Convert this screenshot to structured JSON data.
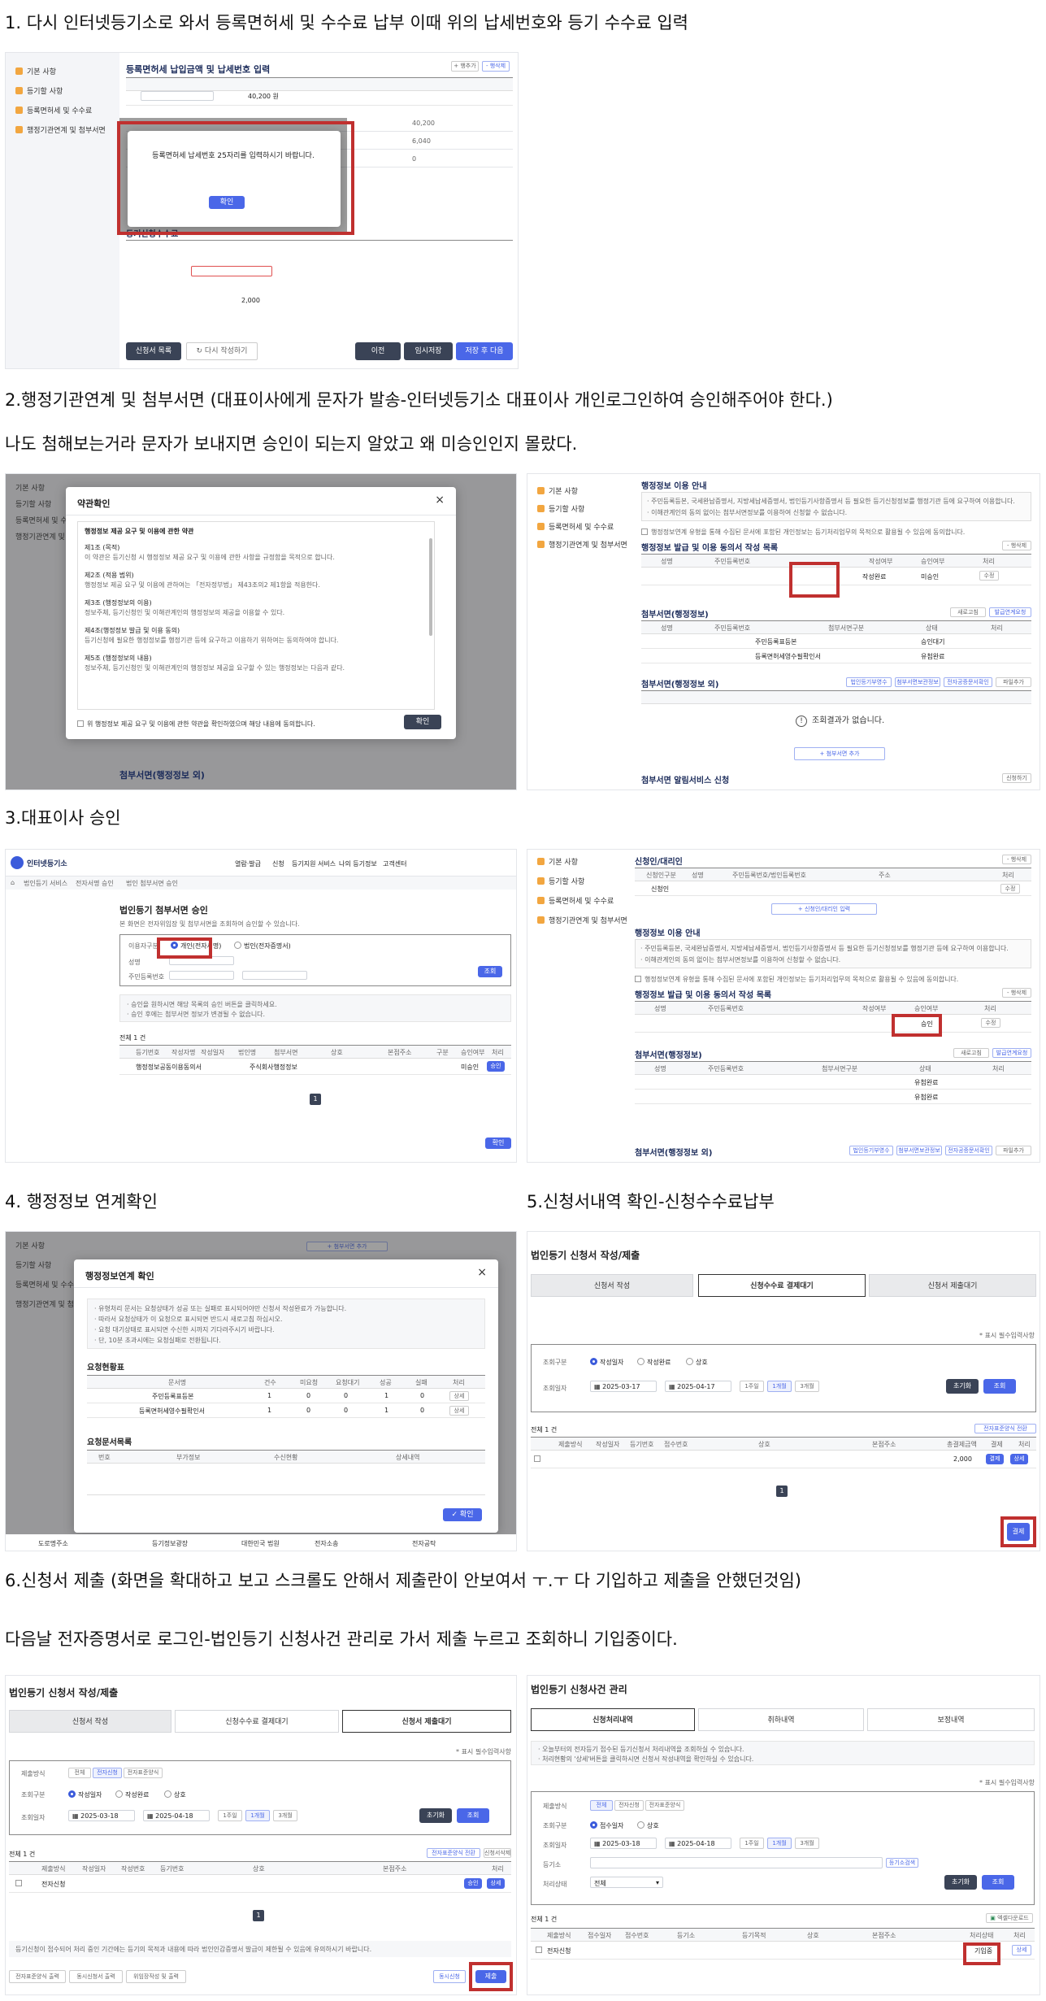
{
  "captions": {
    "c1": "1. 다시 인터넷등기소로 와서 등록면허세 및 수수료 납부 이때 위의 납세번호와 등기 수수료 입력",
    "c2a": "2.행정기관연계 및 첨부서면 (대표이사에게 문자가 발송-인터넷등기소 대표이사 개인로그인하여 승인해주어야 한다.)",
    "c2b": "나도 첨해보는거라 문자가 보내지면 승인이 되는지 알았고 왜 미승인인지 몰랐다.",
    "c3": "3.대표이사 승인",
    "c4": "4. 행정정보 연계확인",
    "c5": "5.신청서내역 확인-신청수수료납부",
    "c6a": "6.신청서 제출 (화면을 확대하고 보고 스크롤도 안해서 제출란이 안보여서 ㅜ.ㅜ 다 기입하고 제출을 안했던것임)",
    "c6b": "다음날 전자증명서로 로그인-법인등기 신청사건 관리로 가서 제출 누르고 조회하니 기입중이다."
  },
  "sidebar": {
    "items": [
      "기본 사항",
      "등기할 사항",
      "등록면허세 및 수수료",
      "행정기관연계 및 첨부서면"
    ]
  },
  "s1": {
    "section_title": "등록면허세 납입금액 및 납세번호 입력",
    "amount": "40,200 원",
    "amount2": "40,200",
    "amount3": "6,040",
    "amount4": "0",
    "fee_title": "등기신청수수료",
    "fee_amount": "2,000",
    "modal_text": "등록면허세 납세번호 25자리를 입력하시기 바랍니다.",
    "modal_ok": "확인",
    "btn_list": "신청서 목록",
    "btn_rewrite": "다시 작성하기",
    "btn_prev": "이전",
    "btn_temp": "임시저장",
    "btn_save_next": "저장 후 다음",
    "add": "+ 행추가",
    "del": "- 행삭제",
    "del2": "- 행추가"
  },
  "s2": {
    "terms_title": "약관확인",
    "terms_heading": "행정정보 제공 요구 및 이용에 관한 약관",
    "terms_lines": [
      "제1조 (목적)",
      "이 약관은 등기신청 시 행정정보 제공 요구 및 이용에 관한 사항을 규정함을 목적으로 합니다.",
      "제2조 (적용 범위)",
      "행정정보 제공 요구 및 이용에 관하여는 「전자정부법」 제43조의2 제1항을 적용한다.",
      "제3조 (행정정보의 이용)",
      "정보주체, 등기신청인 및 이해관계인의 행정정보의 제공을 이용할 수 있다.",
      "제4조(행정정보 발급 및 이용 동의)",
      "등기신청에 필요한 행정정보를 행정기관 등에 요구하고 이용하기 위하여는 동의하여야 합니다.",
      "제5조 (행정정보의 내용)",
      "정보주체, 등기신청인 및 이해관계인의 행정정보 제공을 요구할 수 있는 행정정보는 다음과 같다."
    ],
    "terms_agree": "위 행정정보 제공 요구 및 이용에 관한 약관을 확인하였으며 해당 내용에 동의합니다.",
    "terms_ok": "확인",
    "usage_title": "행정정보 이용 안내",
    "usage_lines": [
      "· 주민등록등본, 국세완납증명서, 지방세납세증명서, 법인등기사항증명서 등 필요한 등기신청정보를 행정기관 등에 요구하여 이용합니다.",
      "· 이해관계인의 동의 없이는 첨부서면정보를 이용하여 신청할 수 없습니다."
    ],
    "consent_check": "행정정보연계 유형을 통해 수집된 문서에 포함된 개인정보는 등기처리업무의 목적으로 활용될 수 있음에 동의합니다.",
    "issue_title": "행정정보 발급 및 이용 동의서 작성 목록",
    "issue_cols": [
      "성명",
      "주민등록번호",
      "작성여부",
      "승인여부",
      "처리"
    ],
    "issue_row": {
      "written": "작성완료",
      "approval": "미승인",
      "action": "수정"
    },
    "attach_title": "첨부서면(행정정보)",
    "attach_cols": [
      "성명",
      "주민등록번호",
      "첨부서면구분",
      "상태",
      "처리"
    ],
    "attach_rows": [
      {
        "type": "주민등록표등본",
        "state": "승인대기"
      },
      {
        "type": "등록면허세영수필확인서",
        "state": "유첨완료"
      }
    ],
    "attach_btns": [
      "새로고침",
      "발급연계요청"
    ],
    "attach2_title": "첨부서면(행정정보 외)",
    "attach2_btns": [
      "법인등기부영수",
      "첨부서면보관정보",
      "전자공증문서확인",
      "파일추가"
    ],
    "no_result": "조회결과가 없습니다.",
    "add_attach": "+ 첨부서면 추가",
    "alarm_title": "첨부서면 알림서비스 신청",
    "alarm_btn": "신청하기"
  },
  "s3": {
    "brand": "인터넷등기소",
    "nav": [
      "열람·발급",
      "신청",
      "등기지원 서비스",
      "나의 등기정보",
      "고객센터"
    ],
    "bread": [
      "법인등기 서비스",
      "전자서명 승인",
      "법인 첨부서면 승인"
    ],
    "title": "법인등기 첨부서면 승인",
    "desc": "본 화면은 전자위임장 및 첨부서면을 조회하여 승인할 수 있습니다.",
    "type_label": "이용자구분",
    "type_opt1": "개인(전자서명)",
    "type_opt2": "법인(전자증명서)",
    "name_label": "성명",
    "rrn_label": "주민등록번호",
    "search": "조회",
    "notes": [
      "· 승인을 원하시면 해당 목록의 승인 버튼을 클릭하세요.",
      "· 승인 후에는 첨부서면 정보가 변경될 수 없습니다."
    ],
    "total": "전체 1 건",
    "cols": [
      "등기번호",
      "작성자명",
      "작성일자",
      "법인명",
      "첨부서면",
      "상호",
      "본점주소",
      "구분",
      "승인여부",
      "처리"
    ],
    "row": {
      "doc": "행정정보공동이용동의서",
      "corp": "주식회사행정정보",
      "status": "미승인",
      "action": "승인"
    },
    "page": "1",
    "confirm": "확인",
    "applicant_title": "신청인/대리인",
    "applicant_cols": [
      "신청인구분",
      "성명",
      "주민등록번호/법인등록번호",
      "주소",
      "처리"
    ],
    "applicant_row": "신청인",
    "applicant_add": "+ 신청인/대리인 입력",
    "issue_approval": "승인",
    "correct": "수정"
  },
  "s4": {
    "title": "행정정보연계 확인",
    "notes": [
      "· 유형처리 문서는 요청상태가 성공 또는 실패로 표시되어야만 신청서 작성완료가 가능합니다.",
      "· 따라서 요청상태가 이 요청으로 표시되면 반드시 새로고침 하십시오.",
      "· 요청 대기상태로 표시되면 수신한 시까지 기다려주시기 바랍니다.",
      "· 단, 10분 초과시에는 요청실패로 전환됩니다."
    ],
    "req_title": "요청현황표",
    "req_cols": [
      "문서명",
      "건수",
      "미요청",
      "요청대기",
      "성공",
      "실패",
      "처리"
    ],
    "req_rows": [
      {
        "doc": "주민등록표등본",
        "cnt": "1",
        "a": "0",
        "b": "0",
        "c": "1",
        "d": "0",
        "act": "상세"
      },
      {
        "doc": "등록면허세영수필확인서",
        "cnt": "1",
        "a": "0",
        "b": "0",
        "c": "1",
        "d": "0",
        "act": "상세"
      }
    ],
    "list_title": "요청문서목록",
    "list_cols": [
      "번호",
      "부가정보",
      "수신현황",
      "상세내역"
    ],
    "ok": "확인",
    "add": "+ 첨부서면 추가",
    "footer": [
      "도로명주소",
      "등기정보광장",
      "대한민국 법원",
      "전자소송",
      "전자공탁"
    ]
  },
  "s5": {
    "title": "법인등기 신청서 작성/제출",
    "tabs": [
      "신청서 작성",
      "신청수수료 결제대기",
      "신청서 제출대기"
    ],
    "required": "* 표시 필수입력사항",
    "cond_label": "조회일자",
    "cond_type": "조회구분",
    "opts": [
      "작성일자",
      "작성완료",
      "상호"
    ],
    "date_from": "2025-03-17",
    "date_to": "2025-04-17",
    "periods": [
      "1주일",
      "1개월",
      "3개월"
    ],
    "reset": "초기화",
    "search": "조회",
    "total": "전체 1 건",
    "cols": [
      "제출방식",
      "작성일자",
      "등기번호",
      "접수번호",
      "상호",
      "본점주소",
      "총결제금액",
      "결제",
      "처리"
    ],
    "row_amount": "2,000",
    "row_btn1": "결제",
    "row_btn2": "상세",
    "top_btns": [
      "전자표준양식 전환"
    ],
    "page": "1",
    "pay": "결제"
  },
  "s6a": {
    "title": "법인등기 신청서 작성/제출",
    "tabs": [
      "신청서 작성",
      "신청수수료 결제대기",
      "신청서 제출대기"
    ],
    "required": "* 표시 필수입력사항",
    "submit_type": "제출방식",
    "submit_opts": [
      "전체",
      "전자신청",
      "전자표준양식"
    ],
    "cond_type": "조회구분",
    "opts": [
      "작성일자",
      "작성완료",
      "상호"
    ],
    "date_label": "조회일자",
    "date_from": "2025-03-18",
    "date_to": "2025-04-18",
    "periods": [
      "1주일",
      "1개월",
      "3개월"
    ],
    "reset": "초기화",
    "search": "조회",
    "total": "전체 1 건",
    "cols": [
      "제출방식",
      "작성일자",
      "작성번호",
      "등기번호",
      "상호",
      "본점주소",
      "처리"
    ],
    "row_type": "전자신청",
    "row_btn1": "승인",
    "row_btn2": "상세",
    "top_btns": [
      "전자표준양식 전환",
      "신청서삭제"
    ],
    "page": "1",
    "notice": "등기신청이 접수되어 처리 중인 기간에는 등기의 목적과 내용에 따라 법인인감증명서 발급이 제한될 수 있음에 유의하시기 바랍니다.",
    "bottom_btns": [
      "전자표준양식 출력",
      "동시신청서 출력",
      "위임장작성 및 출력"
    ],
    "btn_sim": "동시신청",
    "btn_submit": "제출"
  },
  "s6b": {
    "title": "법인등기 신청사건 관리",
    "tabs": [
      "신청처리내역",
      "취하내역",
      "보정내역"
    ],
    "notes": [
      "· 오늘부터의 전자등기 접수된 등기신청서 처리내역을 조회하실 수 있습니다.",
      "· 처리현황의 '상세'버튼을 클릭하시면 신청서 작성내역을 확인하실 수 있습니다."
    ],
    "required": "* 표시 필수입력사항",
    "submit_type": "제출방식",
    "submit_opts": [
      "전체",
      "전자신청",
      "전자표준양식"
    ],
    "cond_type": "조회구분",
    "opts": [
      "접수일자",
      "상호"
    ],
    "date_label": "조회일자",
    "date_from": "2025-03-18",
    "date_to": "2025-04-18",
    "periods": [
      "1주일",
      "1개월",
      "3개월"
    ],
    "reg_label": "등기소",
    "reg_btn": "등기소검색",
    "status_label": "처리상태",
    "status_val": "전체",
    "reset": "초기화",
    "search": "조회",
    "total": "전체 1 건",
    "excel": "엑셀다운로드",
    "cols": [
      "제출방식",
      "접수일자",
      "접수번호",
      "등기소",
      "등기목적",
      "상호",
      "본점주소",
      "처리상태",
      "처리"
    ],
    "row_type": "전자신청",
    "row_status": "기입중",
    "row_btn": "상세"
  },
  "colors": {
    "accent": "#4a67e8",
    "red": "#c0302f",
    "dark": "#3a4356"
  }
}
